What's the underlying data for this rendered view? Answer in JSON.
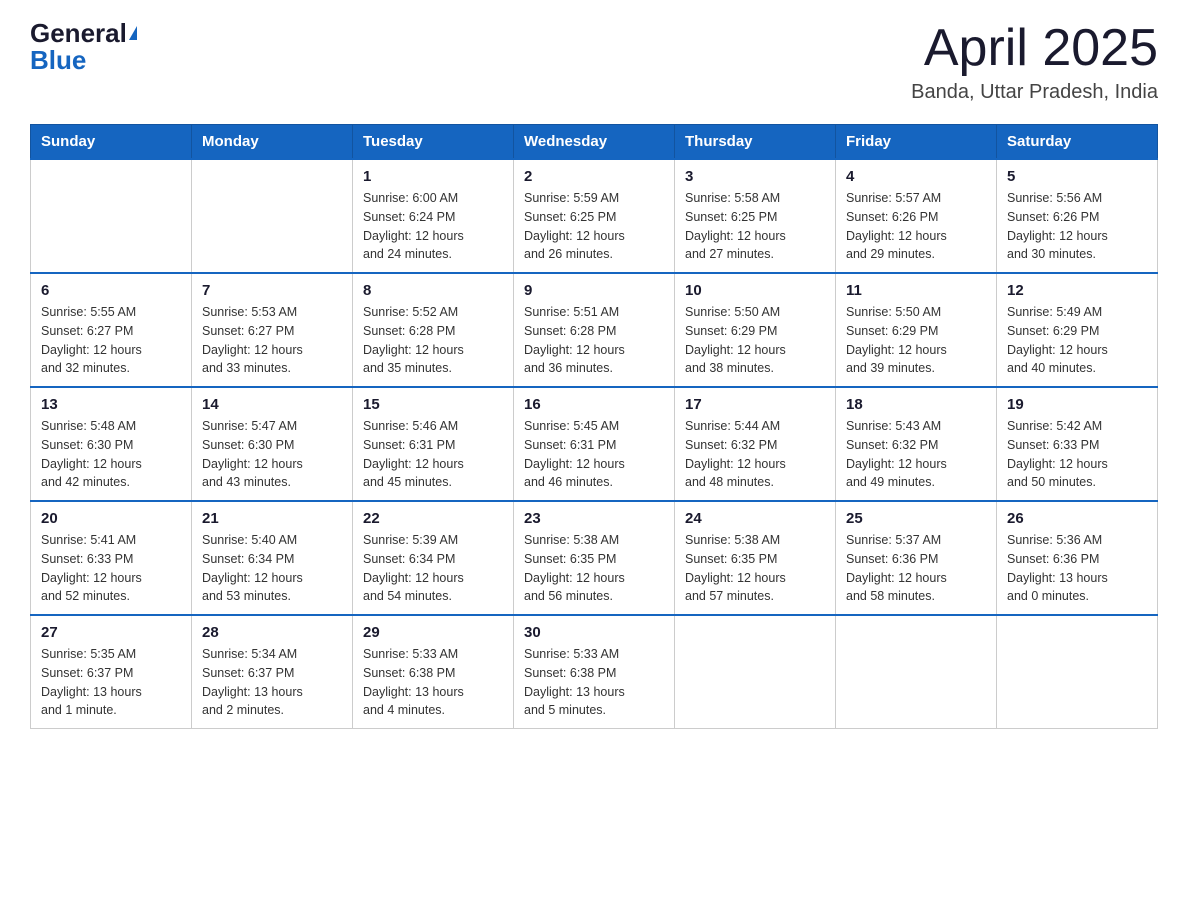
{
  "logo": {
    "general": "General",
    "blue": "Blue"
  },
  "header": {
    "month_year": "April 2025",
    "location": "Banda, Uttar Pradesh, India"
  },
  "weekdays": [
    "Sunday",
    "Monday",
    "Tuesday",
    "Wednesday",
    "Thursday",
    "Friday",
    "Saturday"
  ],
  "weeks": [
    [
      {
        "day": "",
        "info": ""
      },
      {
        "day": "",
        "info": ""
      },
      {
        "day": "1",
        "info": "Sunrise: 6:00 AM\nSunset: 6:24 PM\nDaylight: 12 hours\nand 24 minutes."
      },
      {
        "day": "2",
        "info": "Sunrise: 5:59 AM\nSunset: 6:25 PM\nDaylight: 12 hours\nand 26 minutes."
      },
      {
        "day": "3",
        "info": "Sunrise: 5:58 AM\nSunset: 6:25 PM\nDaylight: 12 hours\nand 27 minutes."
      },
      {
        "day": "4",
        "info": "Sunrise: 5:57 AM\nSunset: 6:26 PM\nDaylight: 12 hours\nand 29 minutes."
      },
      {
        "day": "5",
        "info": "Sunrise: 5:56 AM\nSunset: 6:26 PM\nDaylight: 12 hours\nand 30 minutes."
      }
    ],
    [
      {
        "day": "6",
        "info": "Sunrise: 5:55 AM\nSunset: 6:27 PM\nDaylight: 12 hours\nand 32 minutes."
      },
      {
        "day": "7",
        "info": "Sunrise: 5:53 AM\nSunset: 6:27 PM\nDaylight: 12 hours\nand 33 minutes."
      },
      {
        "day": "8",
        "info": "Sunrise: 5:52 AM\nSunset: 6:28 PM\nDaylight: 12 hours\nand 35 minutes."
      },
      {
        "day": "9",
        "info": "Sunrise: 5:51 AM\nSunset: 6:28 PM\nDaylight: 12 hours\nand 36 minutes."
      },
      {
        "day": "10",
        "info": "Sunrise: 5:50 AM\nSunset: 6:29 PM\nDaylight: 12 hours\nand 38 minutes."
      },
      {
        "day": "11",
        "info": "Sunrise: 5:50 AM\nSunset: 6:29 PM\nDaylight: 12 hours\nand 39 minutes."
      },
      {
        "day": "12",
        "info": "Sunrise: 5:49 AM\nSunset: 6:29 PM\nDaylight: 12 hours\nand 40 minutes."
      }
    ],
    [
      {
        "day": "13",
        "info": "Sunrise: 5:48 AM\nSunset: 6:30 PM\nDaylight: 12 hours\nand 42 minutes."
      },
      {
        "day": "14",
        "info": "Sunrise: 5:47 AM\nSunset: 6:30 PM\nDaylight: 12 hours\nand 43 minutes."
      },
      {
        "day": "15",
        "info": "Sunrise: 5:46 AM\nSunset: 6:31 PM\nDaylight: 12 hours\nand 45 minutes."
      },
      {
        "day": "16",
        "info": "Sunrise: 5:45 AM\nSunset: 6:31 PM\nDaylight: 12 hours\nand 46 minutes."
      },
      {
        "day": "17",
        "info": "Sunrise: 5:44 AM\nSunset: 6:32 PM\nDaylight: 12 hours\nand 48 minutes."
      },
      {
        "day": "18",
        "info": "Sunrise: 5:43 AM\nSunset: 6:32 PM\nDaylight: 12 hours\nand 49 minutes."
      },
      {
        "day": "19",
        "info": "Sunrise: 5:42 AM\nSunset: 6:33 PM\nDaylight: 12 hours\nand 50 minutes."
      }
    ],
    [
      {
        "day": "20",
        "info": "Sunrise: 5:41 AM\nSunset: 6:33 PM\nDaylight: 12 hours\nand 52 minutes."
      },
      {
        "day": "21",
        "info": "Sunrise: 5:40 AM\nSunset: 6:34 PM\nDaylight: 12 hours\nand 53 minutes."
      },
      {
        "day": "22",
        "info": "Sunrise: 5:39 AM\nSunset: 6:34 PM\nDaylight: 12 hours\nand 54 minutes."
      },
      {
        "day": "23",
        "info": "Sunrise: 5:38 AM\nSunset: 6:35 PM\nDaylight: 12 hours\nand 56 minutes."
      },
      {
        "day": "24",
        "info": "Sunrise: 5:38 AM\nSunset: 6:35 PM\nDaylight: 12 hours\nand 57 minutes."
      },
      {
        "day": "25",
        "info": "Sunrise: 5:37 AM\nSunset: 6:36 PM\nDaylight: 12 hours\nand 58 minutes."
      },
      {
        "day": "26",
        "info": "Sunrise: 5:36 AM\nSunset: 6:36 PM\nDaylight: 13 hours\nand 0 minutes."
      }
    ],
    [
      {
        "day": "27",
        "info": "Sunrise: 5:35 AM\nSunset: 6:37 PM\nDaylight: 13 hours\nand 1 minute."
      },
      {
        "day": "28",
        "info": "Sunrise: 5:34 AM\nSunset: 6:37 PM\nDaylight: 13 hours\nand 2 minutes."
      },
      {
        "day": "29",
        "info": "Sunrise: 5:33 AM\nSunset: 6:38 PM\nDaylight: 13 hours\nand 4 minutes."
      },
      {
        "day": "30",
        "info": "Sunrise: 5:33 AM\nSunset: 6:38 PM\nDaylight: 13 hours\nand 5 minutes."
      },
      {
        "day": "",
        "info": ""
      },
      {
        "day": "",
        "info": ""
      },
      {
        "day": "",
        "info": ""
      }
    ]
  ]
}
